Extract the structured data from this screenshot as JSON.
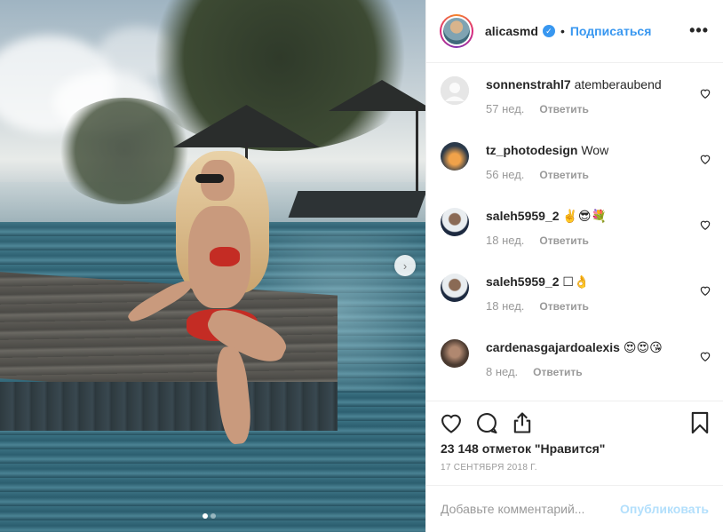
{
  "post": {
    "username": "alicasmd",
    "separator": "•",
    "follow_label": "Подписаться",
    "more_icon": "more-horizontal-icon",
    "accent_color": "#3897f0"
  },
  "media": {
    "slide_count": 2,
    "active_slide": 1,
    "next_arrow": "›"
  },
  "comments": [
    {
      "user": "sonnenstrahl7",
      "text": "atemberaubend",
      "age": "57 нед.",
      "reply": "Ответить"
    },
    {
      "user": "tz_photodesign",
      "text": "Wow",
      "age": "56 нед.",
      "reply": "Ответить"
    },
    {
      "user": "saleh5959_2",
      "text": "✌️😎💐",
      "age": "18 нед.",
      "reply": "Ответить"
    },
    {
      "user": "saleh5959_2",
      "text": "☐👌",
      "age": "18 нед.",
      "reply": "Ответить"
    },
    {
      "user": "cardenasgajardoalexis",
      "text": "😍😍😘",
      "age": "8 нед.",
      "reply": "Ответить"
    }
  ],
  "actions": {
    "likes_text": "23 148 отметок \"Нравится\"",
    "date": "17 сентября 2018 г."
  },
  "add_comment": {
    "placeholder": "Добавьте комментарий...",
    "publish_label": "Опубликовать"
  }
}
